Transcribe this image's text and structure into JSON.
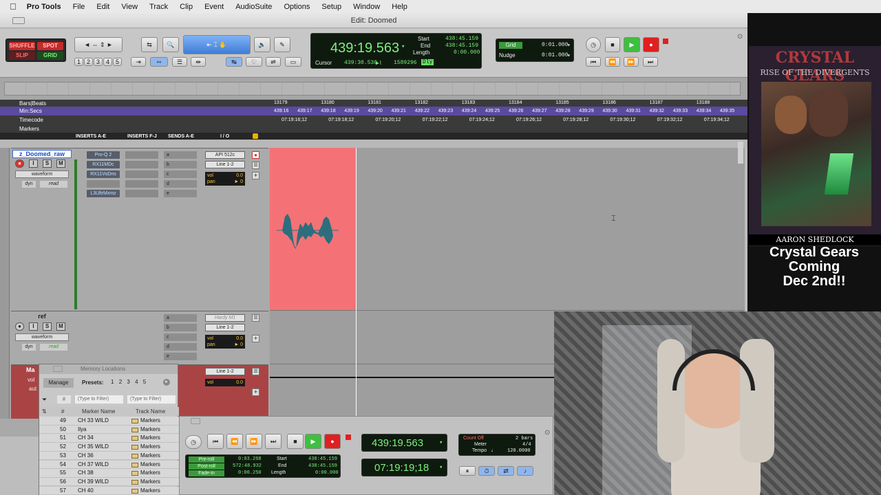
{
  "menubar": {
    "apple": "",
    "app": "Pro Tools",
    "items": [
      "File",
      "Edit",
      "View",
      "Track",
      "Clip",
      "Event",
      "AudioSuite",
      "Options",
      "Setup",
      "Window",
      "Help"
    ]
  },
  "window": {
    "title": "Edit: Doomed"
  },
  "toolbar": {
    "modes": [
      "SHUFFLE",
      "SPOT",
      "SLIP",
      "GRID"
    ],
    "zoom_presets": [
      "1",
      "2",
      "3",
      "4",
      "5"
    ],
    "main_counter": "439:19.563",
    "start_label": "Start",
    "start_value": "438:45.159",
    "end_label": "End",
    "end_value": "438:45.159",
    "length_label": "Length",
    "length_value": "0:00.000",
    "cursor_label": "Cursor",
    "cursor_value": "439:30.530",
    "sample_value": "1589296",
    "dly_label": "Dly",
    "grid_label": "Grid",
    "grid_value": "0:01.000",
    "nudge_label": "Nudge",
    "nudge_value": "0:01.000"
  },
  "rulers": {
    "labels": [
      "Bars|Beats",
      "Min:Secs",
      "Timecode",
      "Markers"
    ],
    "bars": [
      "13179",
      "13180",
      "13181",
      "13182",
      "13183",
      "13184",
      "13185",
      "13186",
      "13187",
      "13188"
    ],
    "minsecs": [
      "439:16",
      "439:17",
      "439:18",
      "439:19",
      "439:20",
      "439:21",
      "439:22",
      "439:23",
      "439:24",
      "439:25",
      "439:26",
      "439:27",
      "439:28",
      "439:29",
      "439:30",
      "439:31",
      "439:32",
      "439:33",
      "439:34",
      "439:35"
    ],
    "timecode": [
      "07:19:16;12",
      "07:19:18;12",
      "07:19:20;12",
      "07:19:22;12",
      "07:19:24;12",
      "07:19:26;12",
      "07:19:28;12",
      "07:19:30;12",
      "07:19:32;12",
      "07:19:34;12"
    ]
  },
  "columns": {
    "inserts_ae": "INSERTS A-E",
    "inserts_fj": "INSERTS F-J",
    "sends_ae": "SENDS A-E",
    "io": "I / O"
  },
  "tracks": [
    {
      "name": "z_Doomed_raw",
      "view": "waveform",
      "auto": "read",
      "dyn": "dyn",
      "inserts": [
        "Pro-Q 2",
        "RX11MDc",
        "RX11VoDns",
        "",
        "L3UltrMxmz"
      ],
      "sends": [
        "a",
        "b",
        "c",
        "d",
        "e"
      ],
      "io_in": "API 512c",
      "io_out": "Line 1-2",
      "vol": "0.0",
      "pan": "0"
    },
    {
      "name": "ref",
      "view": "waveform",
      "auto": "read",
      "dyn": "dyn",
      "inserts": [],
      "sends": [
        "a",
        "b",
        "c",
        "d",
        "e"
      ],
      "io_in": "Hardy M1",
      "io_out": "Line 1-2",
      "vol": "0.0",
      "pan": "0"
    },
    {
      "name": "Ma",
      "io_out": "Line 1-2",
      "vol": "0.0",
      "side_vol": "vol",
      "side_auto": "aut"
    }
  ],
  "solo_labels": {
    "rec": "",
    "input": "I",
    "solo": "S",
    "mute": "M"
  },
  "vol_label": "vol",
  "pan_label": "pan",
  "pan_arrow": "►",
  "memory": {
    "title": "Memory Locations",
    "manage": "Manage",
    "presets": "Presets:",
    "preset_nums": [
      "1",
      "2",
      "3",
      "4",
      "5"
    ],
    "hash": "#",
    "filter_placeholder": "(Type to Filter)",
    "col_num": "#",
    "col_name": "Marker Name",
    "col_track": "Track Name",
    "rows": [
      {
        "num": "49",
        "name": "CH 33 WILD",
        "track": "Markers"
      },
      {
        "num": "50",
        "name": "Ilya",
        "track": "Markers"
      },
      {
        "num": "51",
        "name": "CH 34",
        "track": "Markers"
      },
      {
        "num": "52",
        "name": "CH 35 WILD",
        "track": "Markers"
      },
      {
        "num": "53",
        "name": "CH 36",
        "track": "Markers"
      },
      {
        "num": "54",
        "name": "CH 37 WILD",
        "track": "Markers"
      },
      {
        "num": "55",
        "name": "CH 38",
        "track": "Markers"
      },
      {
        "num": "56",
        "name": "CH 39 WILD",
        "track": "Markers"
      },
      {
        "num": "57",
        "name": "CH 40",
        "track": "Markers"
      }
    ]
  },
  "transport": {
    "preroll_label": "Pre-roll",
    "preroll": "0:03.268",
    "postroll_label": "Post-roll",
    "postroll": "572:48.932",
    "fadein_label": "Fade-in",
    "fadein": "0:00.250",
    "start_label": "Start",
    "start": "438:45.159",
    "end_label": "End",
    "end": "438:45.159",
    "length_label": "Length",
    "length": "0:00.000",
    "main_counter": "439:19.563",
    "sub_counter": "07:19:19;18",
    "countoff": "Count Off",
    "bars": "2 bars",
    "meter_label": "Meter",
    "meter": "4/4",
    "tempo_label": "Tempo",
    "tempo": "120.0000"
  },
  "ad": {
    "title_line1": "CRYSTAL GEARS",
    "title_line2": "RISE OF THE DIVERGENTS",
    "author": "AARON SHEDLOCK",
    "promo": [
      "Crystal Gears",
      "Coming",
      "Dec 2nd!!"
    ]
  },
  "colors": {
    "clip": "#f47276",
    "counter_green": "#7df07d",
    "record_red": "#e02020",
    "play_green": "#3fbf3f"
  }
}
